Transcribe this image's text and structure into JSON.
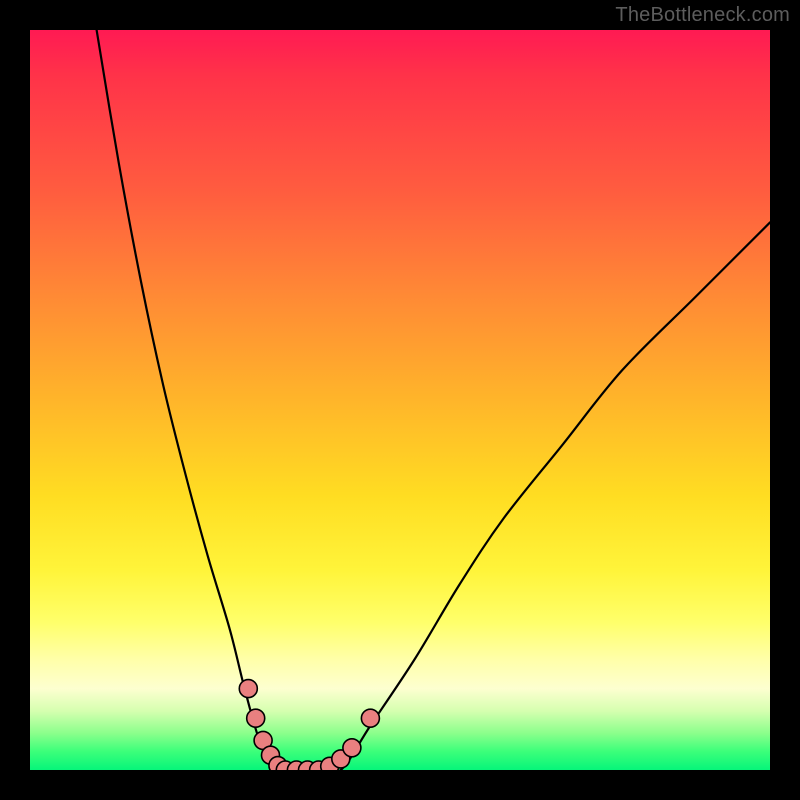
{
  "watermark": "TheBottleneck.com",
  "colors": {
    "bg_black": "#000000",
    "curve": "#000000",
    "marker_fill": "#e98080",
    "marker_stroke": "#000000",
    "gradient_top": "#ff1a53",
    "gradient_bottom": "#06f57a"
  },
  "chart_data": {
    "type": "line",
    "title": "",
    "xlabel": "",
    "ylabel": "",
    "xlim": [
      0,
      100
    ],
    "ylim": [
      0,
      100
    ],
    "grid": false,
    "note": "No axis ticks or labels visible; values estimated from curve shape. y≈0 at valley floor (~x 33–42); y≈100 at top-left (x≈9). Curve represents bottleneck percentage vs configuration.",
    "series": [
      {
        "name": "left-curve",
        "x": [
          9,
          12,
          15,
          18,
          21,
          24,
          27,
          29,
          31,
          33
        ],
        "values": [
          100,
          82,
          66,
          52,
          40,
          29,
          19,
          11,
          4,
          0
        ]
      },
      {
        "name": "valley-floor",
        "x": [
          33,
          36,
          39,
          42
        ],
        "values": [
          0,
          0,
          0,
          0
        ]
      },
      {
        "name": "right-curve",
        "x": [
          42,
          46,
          52,
          58,
          64,
          72,
          80,
          90,
          100
        ],
        "values": [
          0,
          6,
          15,
          25,
          34,
          44,
          54,
          64,
          74
        ]
      }
    ],
    "markers": [
      {
        "x": 29.5,
        "y": 11
      },
      {
        "x": 30.5,
        "y": 7
      },
      {
        "x": 31.5,
        "y": 4
      },
      {
        "x": 32.5,
        "y": 2
      },
      {
        "x": 33.5,
        "y": 0.6
      },
      {
        "x": 34.5,
        "y": 0
      },
      {
        "x": 36.0,
        "y": 0
      },
      {
        "x": 37.5,
        "y": 0
      },
      {
        "x": 39.0,
        "y": 0
      },
      {
        "x": 40.5,
        "y": 0.5
      },
      {
        "x": 42.0,
        "y": 1.5
      },
      {
        "x": 43.5,
        "y": 3
      },
      {
        "x": 46.0,
        "y": 7
      }
    ]
  }
}
